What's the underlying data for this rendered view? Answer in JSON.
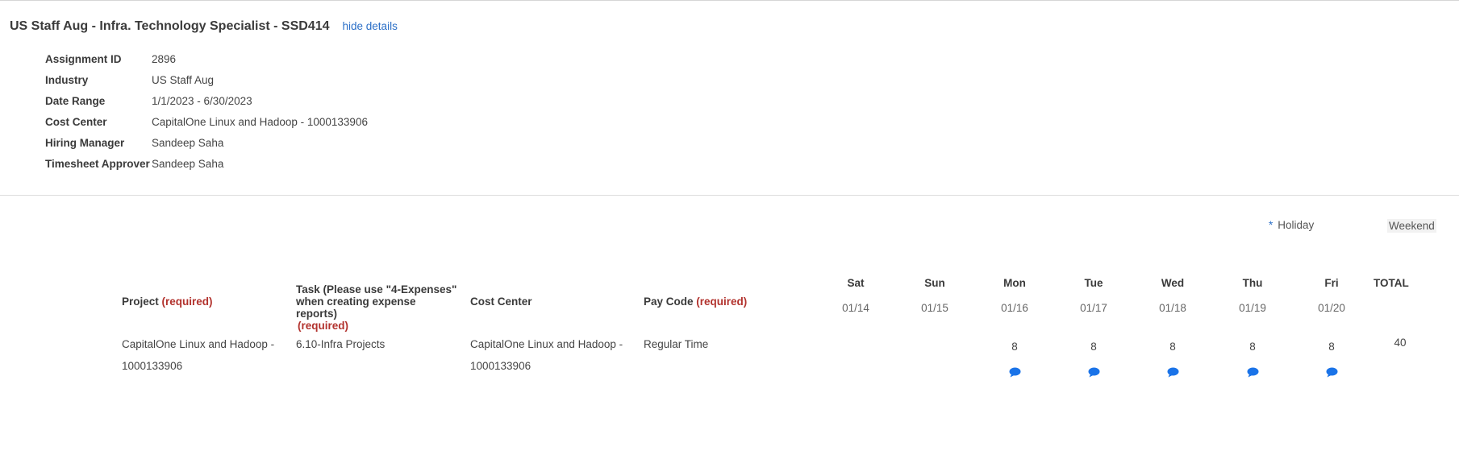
{
  "header": {
    "title": "US Staff Aug - Infra. Technology Specialist - SSD414",
    "toggle_label": "hide details"
  },
  "details": [
    {
      "label": "Assignment ID",
      "value": "2896"
    },
    {
      "label": "Industry",
      "value": "US Staff Aug"
    },
    {
      "label": "Date Range",
      "value": "1/1/2023 - 6/30/2023"
    },
    {
      "label": "Cost Center",
      "value": "CapitalOne Linux and Hadoop - 1000133906"
    },
    {
      "label": "Hiring Manager",
      "value": "Sandeep Saha"
    },
    {
      "label": "Timesheet Approver",
      "value": "Sandeep Saha"
    }
  ],
  "legend": {
    "holiday_marker": "*",
    "holiday": "Holiday",
    "weekend": "Weekend"
  },
  "columns": {
    "project": "Project",
    "project_req": "(required)",
    "task": "Task (Please use \"4-Expenses\" when creating expense reports)",
    "task_req": "(required)",
    "cost_center": "Cost Center",
    "pay_code": "Pay Code",
    "pay_code_req": "(required)",
    "total": "TOTAL"
  },
  "days": [
    {
      "name": "Sat",
      "date": "01/14",
      "hours": ""
    },
    {
      "name": "Sun",
      "date": "01/15",
      "hours": ""
    },
    {
      "name": "Mon",
      "date": "01/16",
      "hours": "8"
    },
    {
      "name": "Tue",
      "date": "01/17",
      "hours": "8"
    },
    {
      "name": "Wed",
      "date": "01/18",
      "hours": "8"
    },
    {
      "name": "Thu",
      "date": "01/19",
      "hours": "8"
    },
    {
      "name": "Fri",
      "date": "01/20",
      "hours": "8"
    }
  ],
  "row": {
    "project": "CapitalOne Linux and Hadoop - 1000133906",
    "task": "6.10-Infra Projects",
    "cost_center": "CapitalOne Linux and Hadoop - 1000133906",
    "pay_code": "Regular Time",
    "total": "40"
  },
  "icons": {
    "comment": "comment-icon"
  },
  "colors": {
    "link": "#2b6fc7",
    "required": "#b2322d",
    "comment_icon": "#1a73e8"
  }
}
